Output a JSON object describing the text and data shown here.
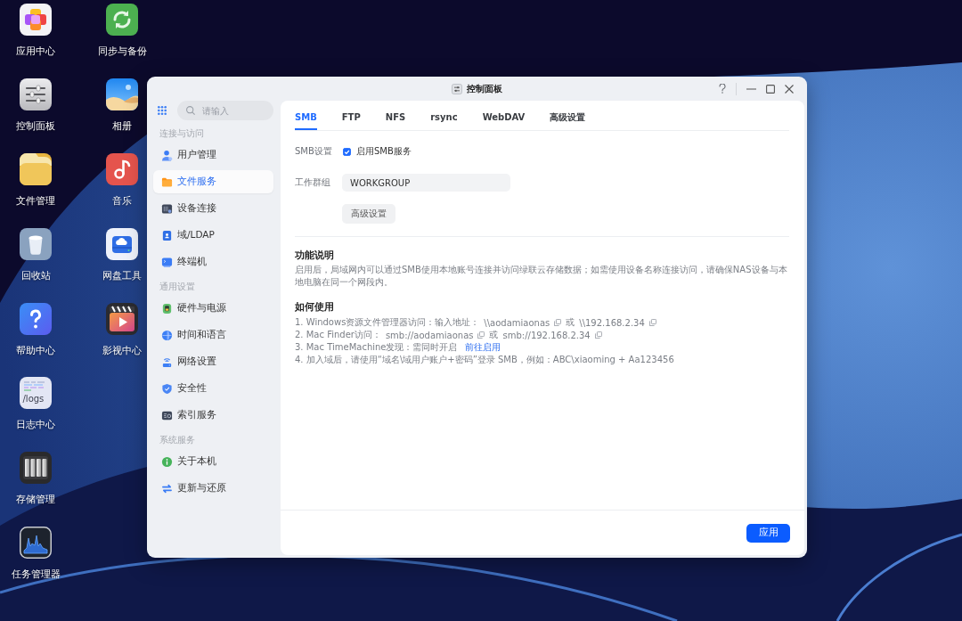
{
  "desktop": {
    "columns": [
      [
        {
          "label": "应用中心",
          "kind": "apps"
        },
        {
          "label": "控制面板",
          "kind": "settings"
        },
        {
          "label": "文件管理",
          "kind": "folder"
        },
        {
          "label": "回收站",
          "kind": "trash"
        },
        {
          "label": "帮助中心",
          "kind": "help"
        },
        {
          "label": "日志中心",
          "kind": "logs",
          "icon_text": "/logs"
        },
        {
          "label": "存储管理",
          "kind": "storage"
        },
        {
          "label": "任务管理器",
          "kind": "monitor"
        }
      ],
      [
        {
          "label": "同步与备份",
          "kind": "sync"
        },
        {
          "label": "相册",
          "kind": "photos"
        },
        {
          "label": "音乐",
          "kind": "music"
        },
        {
          "label": "网盘工具",
          "kind": "drive"
        },
        {
          "label": "影视中心",
          "kind": "video"
        }
      ]
    ]
  },
  "window": {
    "title": "控制面板"
  },
  "sidebar": {
    "search": {
      "placeholder": "请输入"
    },
    "sections": [
      {
        "header": "连接与访问",
        "items": [
          {
            "label": "用户管理",
            "kind": "user",
            "selected": false
          },
          {
            "label": "文件服务",
            "kind": "folder",
            "selected": true
          },
          {
            "label": "设备连接",
            "kind": "device",
            "selected": false
          },
          {
            "label": "域/LDAP",
            "kind": "domain",
            "selected": false
          },
          {
            "label": "终端机",
            "kind": "terminal",
            "selected": false
          }
        ]
      },
      {
        "header": "通用设置",
        "items": [
          {
            "label": "硬件与电源",
            "kind": "hardware",
            "selected": false
          },
          {
            "label": "时间和语言",
            "kind": "globe",
            "selected": false
          },
          {
            "label": "网络设置",
            "kind": "network",
            "selected": false
          },
          {
            "label": "安全性",
            "kind": "shield",
            "selected": false
          },
          {
            "label": "索引服务",
            "kind": "index",
            "selected": false
          }
        ]
      },
      {
        "header": "系统服务",
        "items": [
          {
            "label": "关于本机",
            "kind": "info",
            "selected": false
          },
          {
            "label": "更新与还原",
            "kind": "update",
            "selected": false
          }
        ]
      }
    ]
  },
  "tabs": [
    {
      "label": "SMB",
      "selected": true
    },
    {
      "label": "FTP",
      "selected": false
    },
    {
      "label": "NFS",
      "selected": false
    },
    {
      "label": "rsync",
      "selected": false
    },
    {
      "label": "WebDAV",
      "selected": false
    },
    {
      "label": "高级设置",
      "selected": false
    }
  ],
  "smb": {
    "label": "SMB设置",
    "checkbox": {
      "label": "启用SMB服务",
      "checked": true
    }
  },
  "workgroup": {
    "label": "工作群组",
    "value": "WORKGROUP"
  },
  "advanced_button": "高级设置",
  "description": {
    "title": "功能说明",
    "text": "启用后，局域网内可以通过SMB使用本地账号连接并访问绿联云存储数据；如需使用设备名称连接访问，请确保NAS设备与本地电脑在同一个网段内。"
  },
  "usage": {
    "title": "如何使用",
    "steps": [
      {
        "parts": [
          {
            "kind": "text",
            "text": "1. Windows资源文件管理器访问：输入地址："
          },
          {
            "kind": "address",
            "text": "\\\\aodamiaonas"
          },
          {
            "kind": "copy"
          },
          {
            "kind": "text",
            "text": "或"
          },
          {
            "kind": "address",
            "text": "\\\\192.168.2.34"
          },
          {
            "kind": "copy"
          }
        ]
      },
      {
        "parts": [
          {
            "kind": "text",
            "text": "2. Mac Finder访问："
          },
          {
            "kind": "address",
            "text": "smb://aodamiaonas"
          },
          {
            "kind": "copy"
          },
          {
            "kind": "text",
            "text": "或"
          },
          {
            "kind": "address",
            "text": "smb://192.168.2.34"
          },
          {
            "kind": "copy"
          }
        ]
      },
      {
        "parts": [
          {
            "kind": "text",
            "text": "3. Mac TimeMachine发现：需同时开启"
          },
          {
            "kind": "link",
            "text": "前往启用"
          }
        ]
      },
      {
        "parts": [
          {
            "kind": "text",
            "text": "4. 加入域后，请使用“域名\\域用户账户+密码”登录 SMB，例如：ABC\\xiaoming + Aa123456"
          }
        ]
      }
    ]
  },
  "footer": {
    "apply_button": "应用"
  }
}
